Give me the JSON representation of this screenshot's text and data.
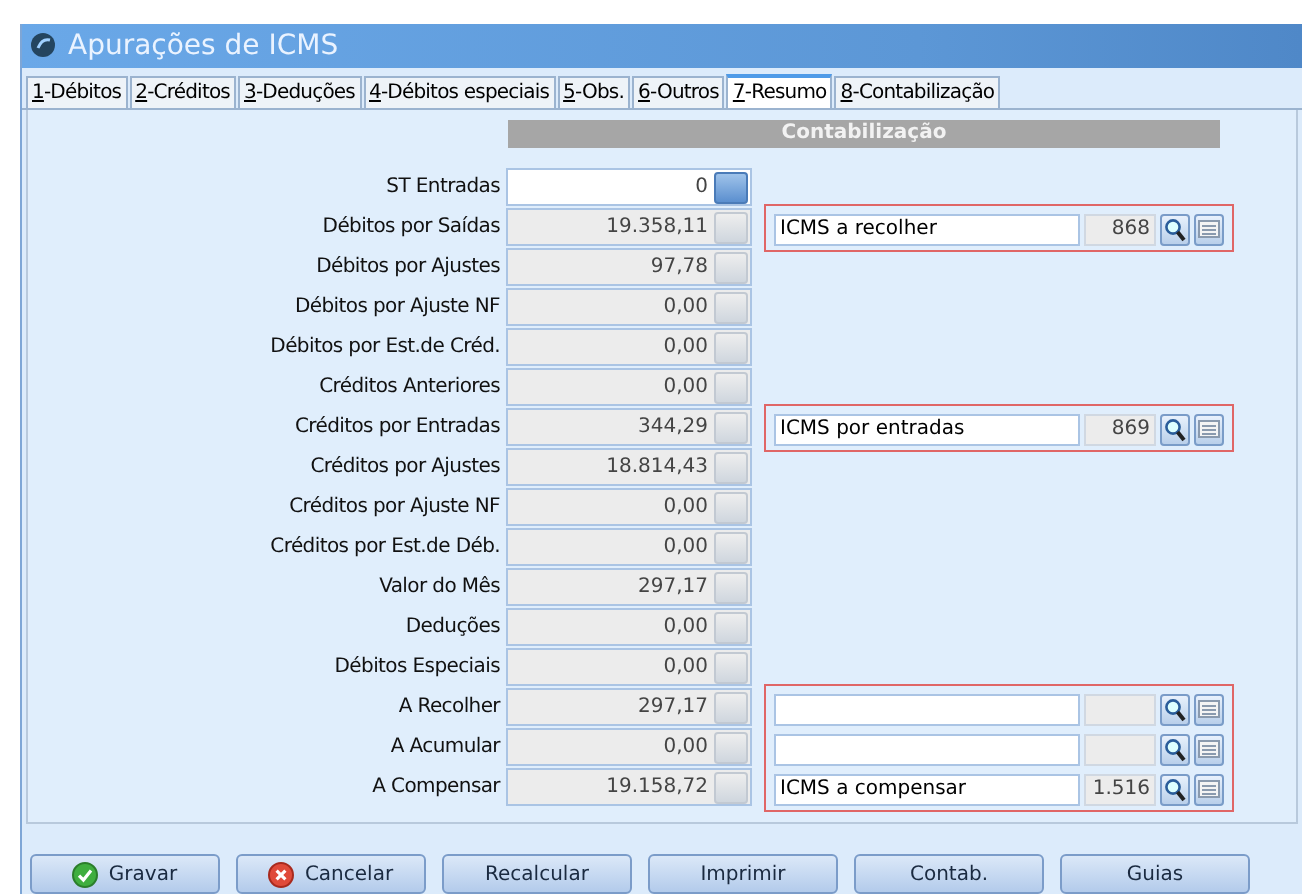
{
  "window": {
    "title": "Apurações de ICMS"
  },
  "tabs": [
    {
      "label": "1-Débitos",
      "selected": false
    },
    {
      "label": "2-Créditos",
      "selected": false
    },
    {
      "label": "3-Deduções",
      "selected": false
    },
    {
      "label": "4-Débitos especiais",
      "selected": false
    },
    {
      "label": "5-Obs.",
      "selected": false
    },
    {
      "label": "6-Outros",
      "selected": false
    },
    {
      "label": "7-Resumo",
      "selected": true
    },
    {
      "label": "8-Contabilização",
      "selected": false
    }
  ],
  "section_header": "Contabilização",
  "rows": [
    {
      "label": "ST Entradas",
      "value": "0",
      "editable": true
    },
    {
      "label": "Débitos por Saídas",
      "value": "19.358,11",
      "editable": false,
      "account": {
        "description": "ICMS a recolher",
        "code": "868"
      }
    },
    {
      "label": "Débitos por Ajustes",
      "value": "97,78",
      "editable": false
    },
    {
      "label": "Débitos por Ajuste NF",
      "value": "0,00",
      "editable": false
    },
    {
      "label": "Débitos por Est.de Créd.",
      "value": "0,00",
      "editable": false
    },
    {
      "label": "Créditos Anteriores",
      "value": "0,00",
      "editable": false
    },
    {
      "label": "Créditos por Entradas",
      "value": "344,29",
      "editable": false,
      "account": {
        "description": "ICMS por entradas",
        "code": "869"
      }
    },
    {
      "label": "Créditos por Ajustes",
      "value": "18.814,43",
      "editable": false
    },
    {
      "label": "Créditos por Ajuste NF",
      "value": "0,00",
      "editable": false
    },
    {
      "label": "Créditos por Est.de Déb.",
      "value": "0,00",
      "editable": false
    },
    {
      "label": "Valor do Mês",
      "value": "297,17",
      "editable": false
    },
    {
      "label": "Deduções",
      "value": "0,00",
      "editable": false
    },
    {
      "label": "Débitos Especiais",
      "value": "0,00",
      "editable": false
    },
    {
      "label": "A Recolher",
      "value": "297,17",
      "editable": false,
      "account": {}
    },
    {
      "label": "A Acumular",
      "value": "0,00",
      "editable": false,
      "account": {}
    },
    {
      "label": "A Compensar",
      "value": "19.158,72",
      "editable": false,
      "account": {
        "description": "ICMS a compensar",
        "code": "1.516"
      }
    }
  ],
  "buttons": [
    {
      "label": "Gravar",
      "kind": "ok"
    },
    {
      "label": "Cancelar",
      "kind": "cancel"
    },
    {
      "label": "Recalcular",
      "kind": "plain"
    },
    {
      "label": "Imprimir",
      "kind": "plain"
    },
    {
      "label": "Contab.",
      "kind": "plain"
    },
    {
      "label": "Guias",
      "kind": "plain"
    }
  ]
}
